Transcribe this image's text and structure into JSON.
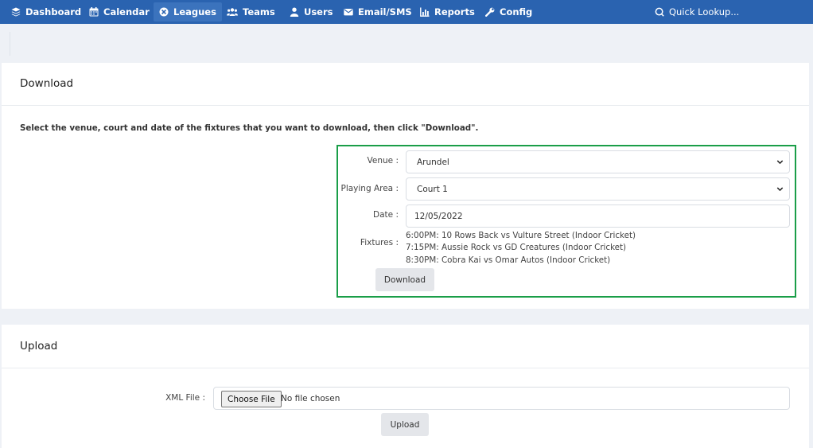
{
  "nav": {
    "items": [
      {
        "label": "Dashboard",
        "icon": "layers-icon"
      },
      {
        "label": "Calendar",
        "icon": "calendar-icon"
      },
      {
        "label": "Leagues",
        "icon": "leagues-icon",
        "active": true
      },
      {
        "label": "Teams",
        "icon": "users-group-icon"
      },
      {
        "label": "Users",
        "icon": "user-icon"
      },
      {
        "label": "Email/SMS",
        "icon": "envelope-icon"
      },
      {
        "label": "Reports",
        "icon": "bar-chart-icon"
      },
      {
        "label": "Config",
        "icon": "wrench-icon"
      }
    ],
    "quick_lookup": "Quick Lookup..."
  },
  "download": {
    "title": "Download",
    "instructions": "Select the venue, court and date of the fixtures that you want to download, then click \"Download\".",
    "venue_label": "Venue :",
    "venue_value": "Arundel",
    "area_label": "Playing Area :",
    "area_value": "Court 1",
    "date_label": "Date :",
    "date_value": "12/05/2022",
    "fixtures_label": "Fixtures :",
    "fixtures": [
      "6:00PM: 10 Rows Back vs Vulture Street (Indoor Cricket)",
      "7:15PM: Aussie Rock vs GD Creatures (Indoor Cricket)",
      "8:30PM: Cobra Kai vs Omar Autos (Indoor Cricket)"
    ],
    "button": "Download"
  },
  "upload": {
    "title": "Upload",
    "file_label": "XML File :",
    "choose_button": "Choose File",
    "no_file": "No file chosen",
    "button": "Upload"
  },
  "colors": {
    "nav_bg": "#2a63b0",
    "highlight_border": "#1a9e48",
    "page_bg": "#eef1f6"
  }
}
